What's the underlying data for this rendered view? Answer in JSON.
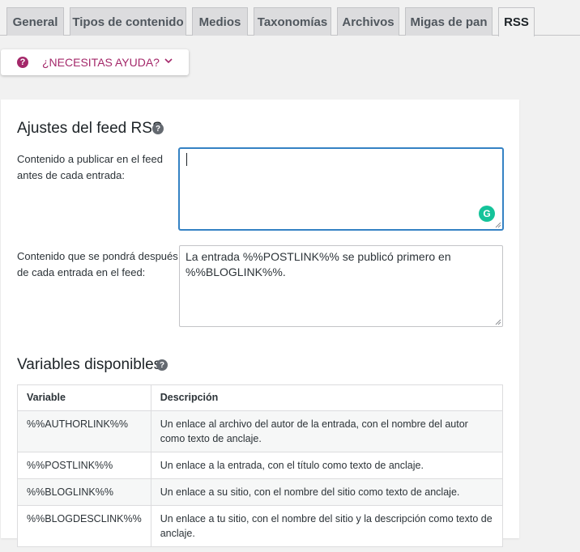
{
  "tabs": [
    {
      "label": "General"
    },
    {
      "label": "Tipos de contenido"
    },
    {
      "label": "Medios"
    },
    {
      "label": "Taxonomías"
    },
    {
      "label": "Archivos"
    },
    {
      "label": "Migas de pan"
    },
    {
      "label": "RSS",
      "active": true
    }
  ],
  "help": {
    "label": "¿NECESITAS AYUDA?",
    "icon": "question-icon",
    "chevron": "chevron-down-icon"
  },
  "colors": {
    "brand": "#a4286a",
    "focus": "#3582c4",
    "grammarly": "#15c39a"
  },
  "rss_settings": {
    "title": "Ajustes del feed RSS",
    "before_label": "Contenido a publicar en el feed antes de cada entrada:",
    "before_value": "",
    "after_label": "Contenido que se pondrá después de cada entrada en el feed:",
    "after_value": "La entrada %%POSTLINK%% se publicó primero en %%BLOGLINK%%."
  },
  "variables": {
    "title": "Variables disponibles",
    "headers": {
      "variable": "Variable",
      "description": "Descripción"
    },
    "rows": [
      {
        "variable": "%%AUTHORLINK%%",
        "description": "Un enlace al archivo del autor de la entrada, con el nombre del autor como texto de anclaje."
      },
      {
        "variable": "%%POSTLINK%%",
        "description": "Un enlace a la entrada, con el título como texto de anclaje."
      },
      {
        "variable": "%%BLOGLINK%%",
        "description": "Un enlace a su sitio, con el nombre del sitio como texto de anclaje."
      },
      {
        "variable": "%%BLOGDESCLINK%%",
        "description": "Un enlace a tu sitio, con el nombre del sitio y la descripción como texto de anclaje."
      }
    ]
  }
}
